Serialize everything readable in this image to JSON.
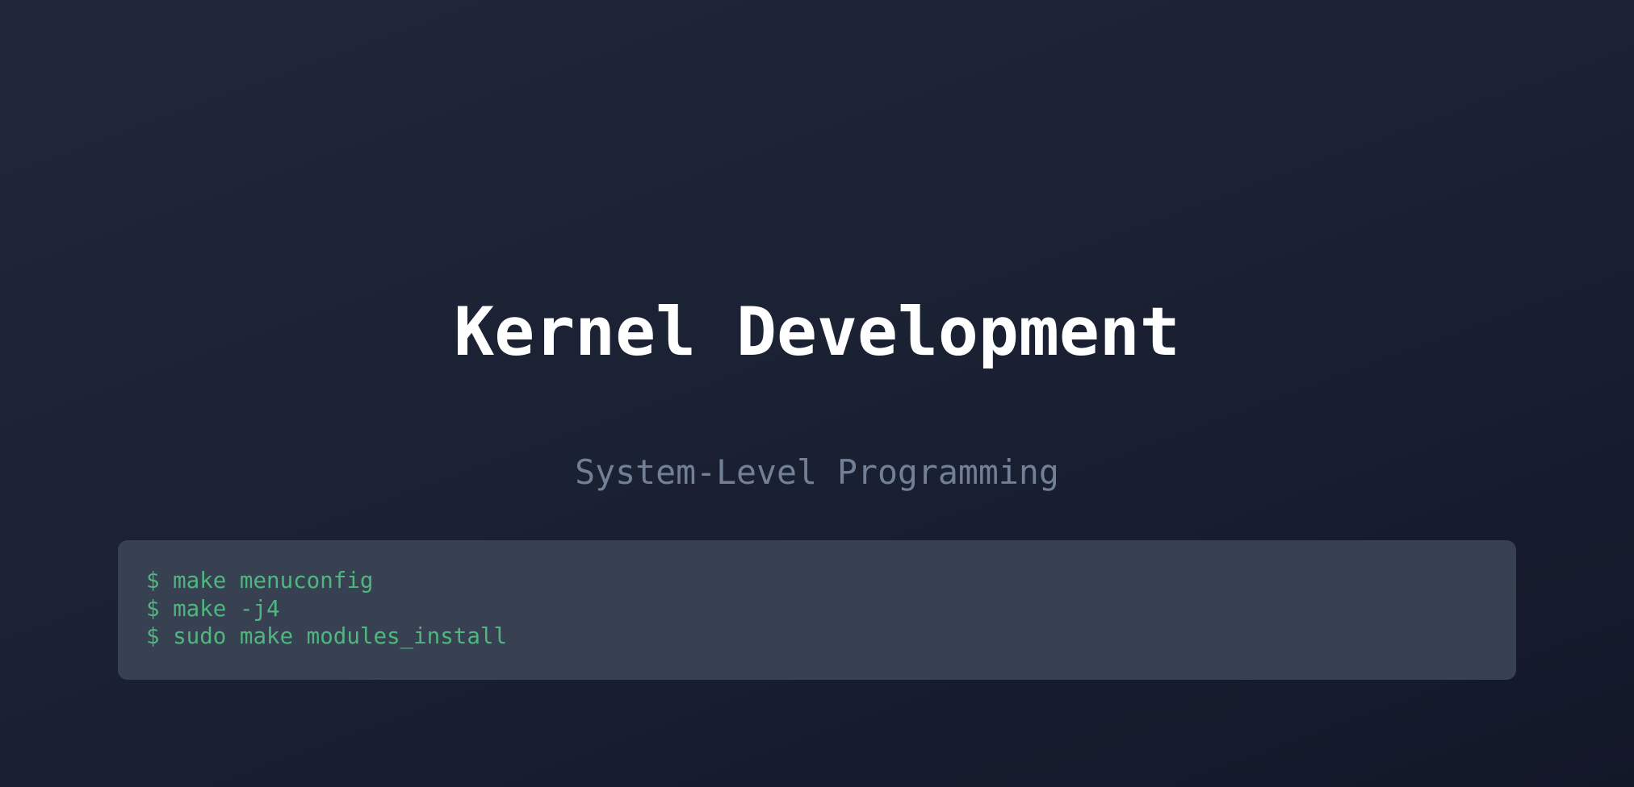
{
  "title": "Kernel Development",
  "subtitle": "System-Level Programming",
  "code": {
    "lines": [
      "$ make menuconfig",
      "$ make -j4",
      "$ sudo make modules_install"
    ]
  },
  "colors": {
    "background": "#1a2133",
    "title": "#ffffff",
    "subtitle": "#718096",
    "code_background": "#374151",
    "code_text": "#4fb67f"
  }
}
